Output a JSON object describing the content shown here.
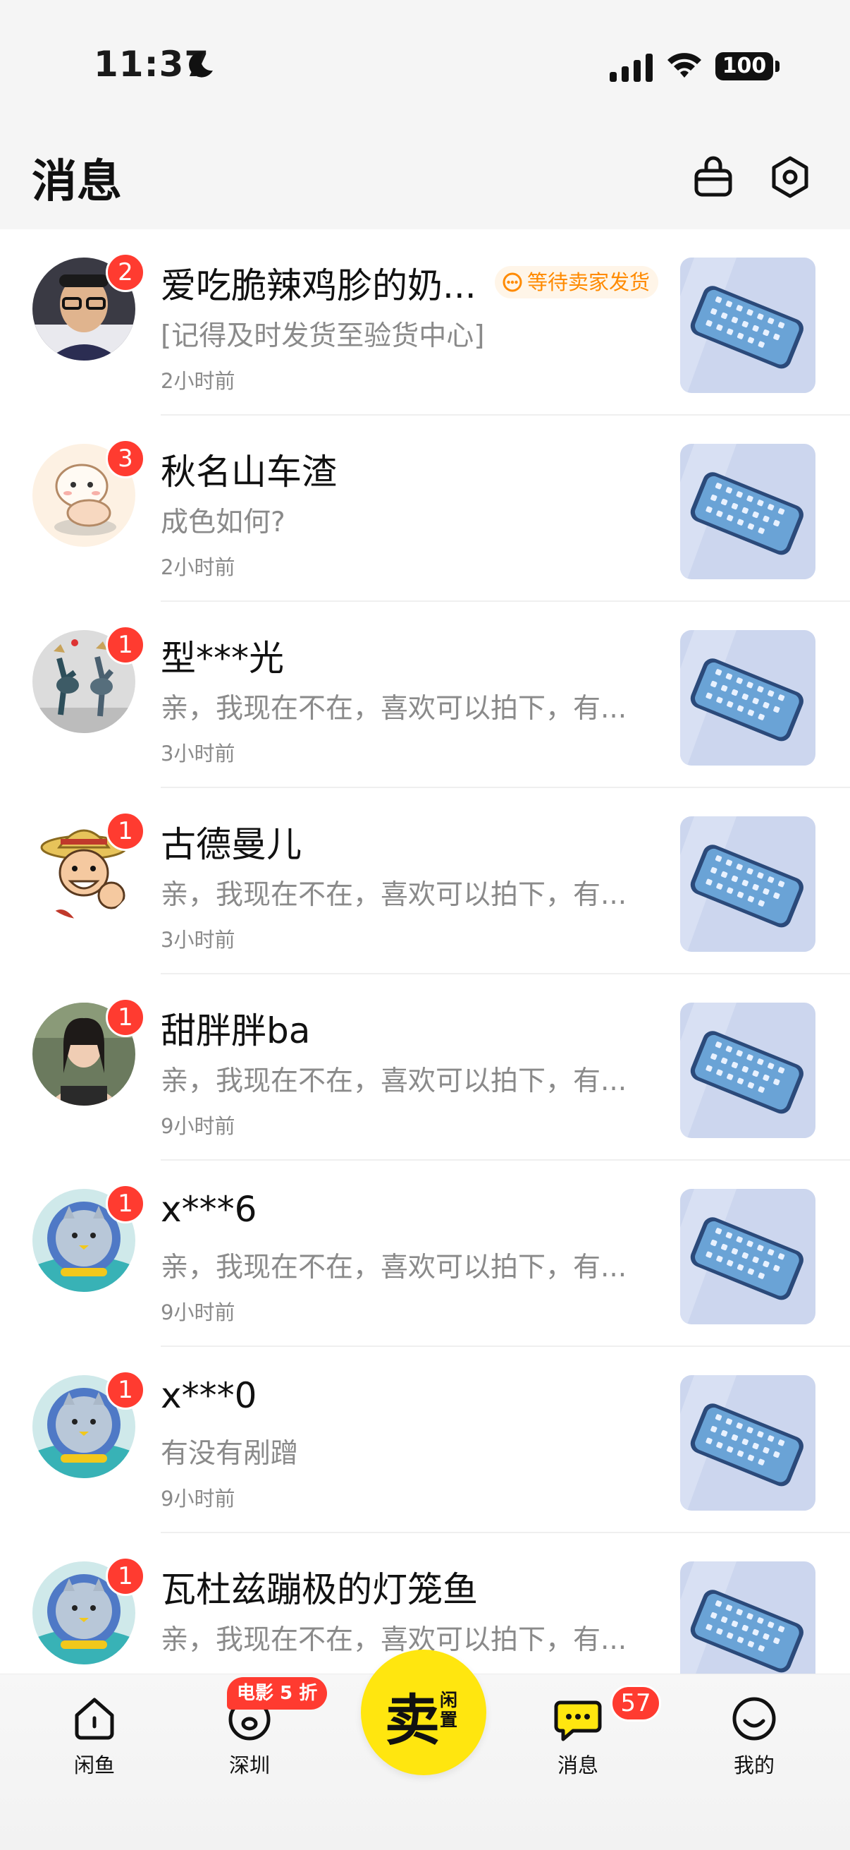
{
  "status_bar": {
    "time": "11:37",
    "battery": "100"
  },
  "header": {
    "title": "消息"
  },
  "colors": {
    "badge": "#ff3b30",
    "tag_text": "#ff8a00",
    "sell_button": "#ffe60f",
    "muted_text": "#8a8a8a"
  },
  "conversations": [
    {
      "name": "爱吃脆辣鸡胗的奶...",
      "tag": "等待卖家发货",
      "preview": "[记得及时发货至验货中心]",
      "time": "2小时前",
      "unread": "2"
    },
    {
      "name": "秋名山车渣",
      "preview": "成色如何?",
      "time": "2小时前",
      "unread": "3"
    },
    {
      "name": "型***光",
      "preview": "亲，我现在不在，喜欢可以拍下，有...",
      "time": "3小时前",
      "unread": "1"
    },
    {
      "name": "古德曼儿",
      "preview": "亲，我现在不在，喜欢可以拍下，有...",
      "time": "3小时前",
      "unread": "1"
    },
    {
      "name": "甜胖胖ba",
      "preview": "亲，我现在不在，喜欢可以拍下，有...",
      "time": "9小时前",
      "unread": "1"
    },
    {
      "name": "x***6",
      "preview": "亲，我现在不在，喜欢可以拍下，有...",
      "time": "9小时前",
      "unread": "1"
    },
    {
      "name": "x***0",
      "preview": "有没有剐蹭",
      "time": "9小时前",
      "unread": "1"
    },
    {
      "name": "瓦杜兹蹦极的灯笼鱼",
      "preview": "亲，我现在不在，喜欢可以拍下，有...",
      "time": "",
      "unread": "1"
    }
  ],
  "tabbar": {
    "home": "闲鱼",
    "city": "深圳",
    "city_promo": "电影 5 折",
    "sell_main": "卖",
    "sell_sub": "闲置",
    "messages": "消息",
    "messages_count": "57",
    "me": "我的"
  }
}
